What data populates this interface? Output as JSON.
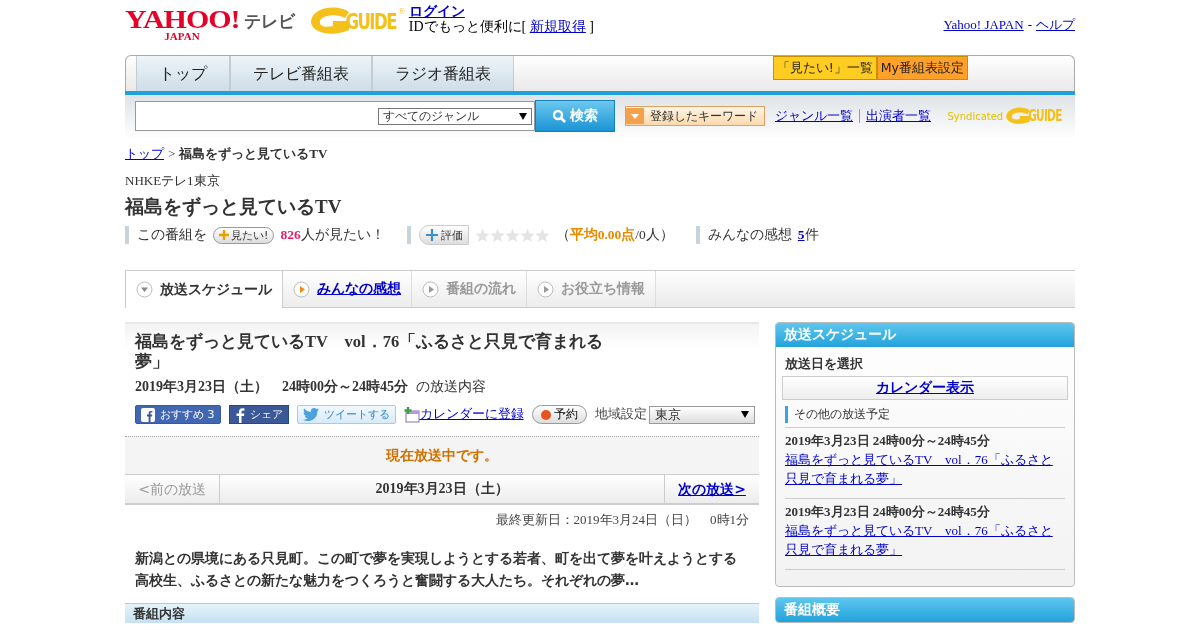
{
  "header": {
    "logo": {
      "wordmark": "YAHOO!",
      "sub": "JAPAN",
      "service": "テレビ"
    },
    "partner_logo": {
      "text": "GUIDE",
      "mark": "®"
    },
    "login_link": "ログイン",
    "signup_prefix": "IDでもっと便利に[",
    "signup_link": "新規取得",
    "signup_suffix": "]",
    "top_links": [
      "Yahoo! JAPAN",
      "ヘルプ"
    ],
    "top_links_separator": "-"
  },
  "nav": {
    "tabs": [
      {
        "label": "トップ"
      },
      {
        "label": "テレビ番組表"
      },
      {
        "label": "ラジオ番組表"
      }
    ],
    "buttons": [
      {
        "label": "「見たい!」一覧",
        "color": "#ffcc22"
      },
      {
        "label": "My番組表設定",
        "color": "#ffa028"
      }
    ]
  },
  "search": {
    "genre": "すべてのジャンル",
    "button": "検索",
    "keyword_button": "登録したキーワード",
    "links": [
      "ジャンル一覧",
      "出演者一覧"
    ],
    "syndicated": "Syndicated",
    "syndicated_logo": "GUIDE"
  },
  "breadcrumb": {
    "items": [
      {
        "label": "トップ"
      },
      {
        "label": "福島をずっと見ているTV"
      }
    ],
    "separator": ">"
  },
  "program": {
    "channel": "NHKEテレ1東京",
    "title": "福島をずっと見ているTV",
    "want_prefix": "この番組を",
    "want_button": "見たい!",
    "want_count": "826",
    "want_suffix": "人が見たい！",
    "rate_button": "評価",
    "stars": 0,
    "average": "（**平均0.00点**/0人）",
    "impressions_label": "みんなの感想",
    "impressions_count": "5",
    "impressions_unit": "件"
  },
  "sub_tabs": [
    {
      "label": "放送スケジュール",
      "selected": true,
      "disabled": false
    },
    {
      "label": "みんなの感想",
      "selected": false,
      "disabled": false
    },
    {
      "label": "番組の流れ",
      "selected": false,
      "disabled": true
    },
    {
      "label": "お役立ち情報",
      "selected": false,
      "disabled": true
    }
  ],
  "episode": {
    "title": "福島をずっと見ているTV　vol．76「ふるさと只見で育まれる夢」",
    "datetime": "2019年3月23日（土）　24時00分～24時45分",
    "datetime_suffix": "の放送内容",
    "share": [
      {
        "kind": "like",
        "label": "おすすめ",
        "count": "3"
      },
      {
        "kind": "share",
        "label": "シェア"
      },
      {
        "kind": "tweet",
        "label": "ツイートする"
      }
    ],
    "calendar_link": "カレンダーに登録",
    "reserve_button": "予約",
    "region_label": "地域設定",
    "region": "東京",
    "on_air": "現在放送中です。",
    "prev": {
      "label": "<前の放送",
      "disabled": true
    },
    "current_date": "2019年3月23日（土）",
    "next": {
      "label": "次の放送>",
      "disabled": false
    },
    "updated": "最終更新日：2019年3月24日（日）　0時1分",
    "summary": "新潟との県境にある只見町。この町で夢を実現しようとする若者、町を出て夢を叶えようとする高校生、ふるさとの新たな魅力をつくろうと奮闘する大人たち。それぞれの夢…",
    "section": "番組内容"
  },
  "sidebar": {
    "schedule": {
      "title": "放送スケジュール",
      "date_label": "放送日を選択",
      "calendar_button": "カレンダー表示",
      "other_label": "その他の放送予定",
      "items": [
        {
          "time": "2019年3月23日  24時00分～24時45分",
          "title": "福島をずっと見ているTV　vol．76「ふるさと只見で育まれる夢」"
        },
        {
          "time": "2019年3月23日  24時00分～24時45分",
          "title": "福島をずっと見ているTV　vol．76「ふるさと只見で育まれる夢」"
        }
      ]
    },
    "overview": {
      "title": "番組概要"
    }
  }
}
